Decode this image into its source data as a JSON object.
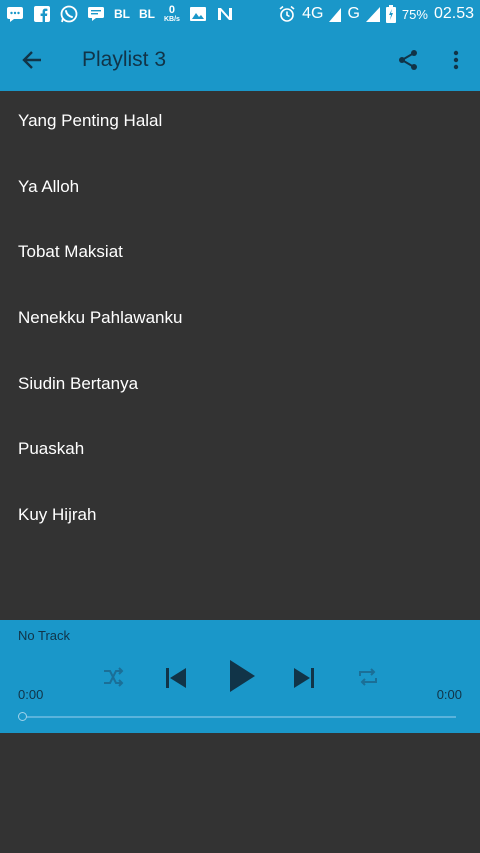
{
  "status_bar": {
    "icons": [
      "message-icon",
      "facebook-icon",
      "whatsapp-icon",
      "chat-icon",
      "photo-icon",
      "n-icon",
      "alarm-icon",
      "signal-icon",
      "battery-icon"
    ],
    "bl1": "BL",
    "bl2": "BL",
    "net_value": "0",
    "net_unit": "KB/s",
    "network_4g": "4G",
    "network_g": "G",
    "battery": "75%",
    "time": "02.53"
  },
  "app_bar": {
    "title": "Playlist 3"
  },
  "playlist": {
    "items": [
      {
        "label": "Yang Penting Halal"
      },
      {
        "label": "Ya Alloh"
      },
      {
        "label": "Tobat Maksiat"
      },
      {
        "label": "Nenekku Pahlawanku"
      },
      {
        "label": "Siudin Bertanya"
      },
      {
        "label": "Puaskah"
      },
      {
        "label": "Kuy Hijrah"
      }
    ]
  },
  "player": {
    "track": "No Track",
    "elapsed": "0:00",
    "duration": "0:00",
    "progress": 0
  },
  "colors": {
    "accent": "#1a97c9",
    "background": "#333333",
    "dark_text": "#113448"
  }
}
